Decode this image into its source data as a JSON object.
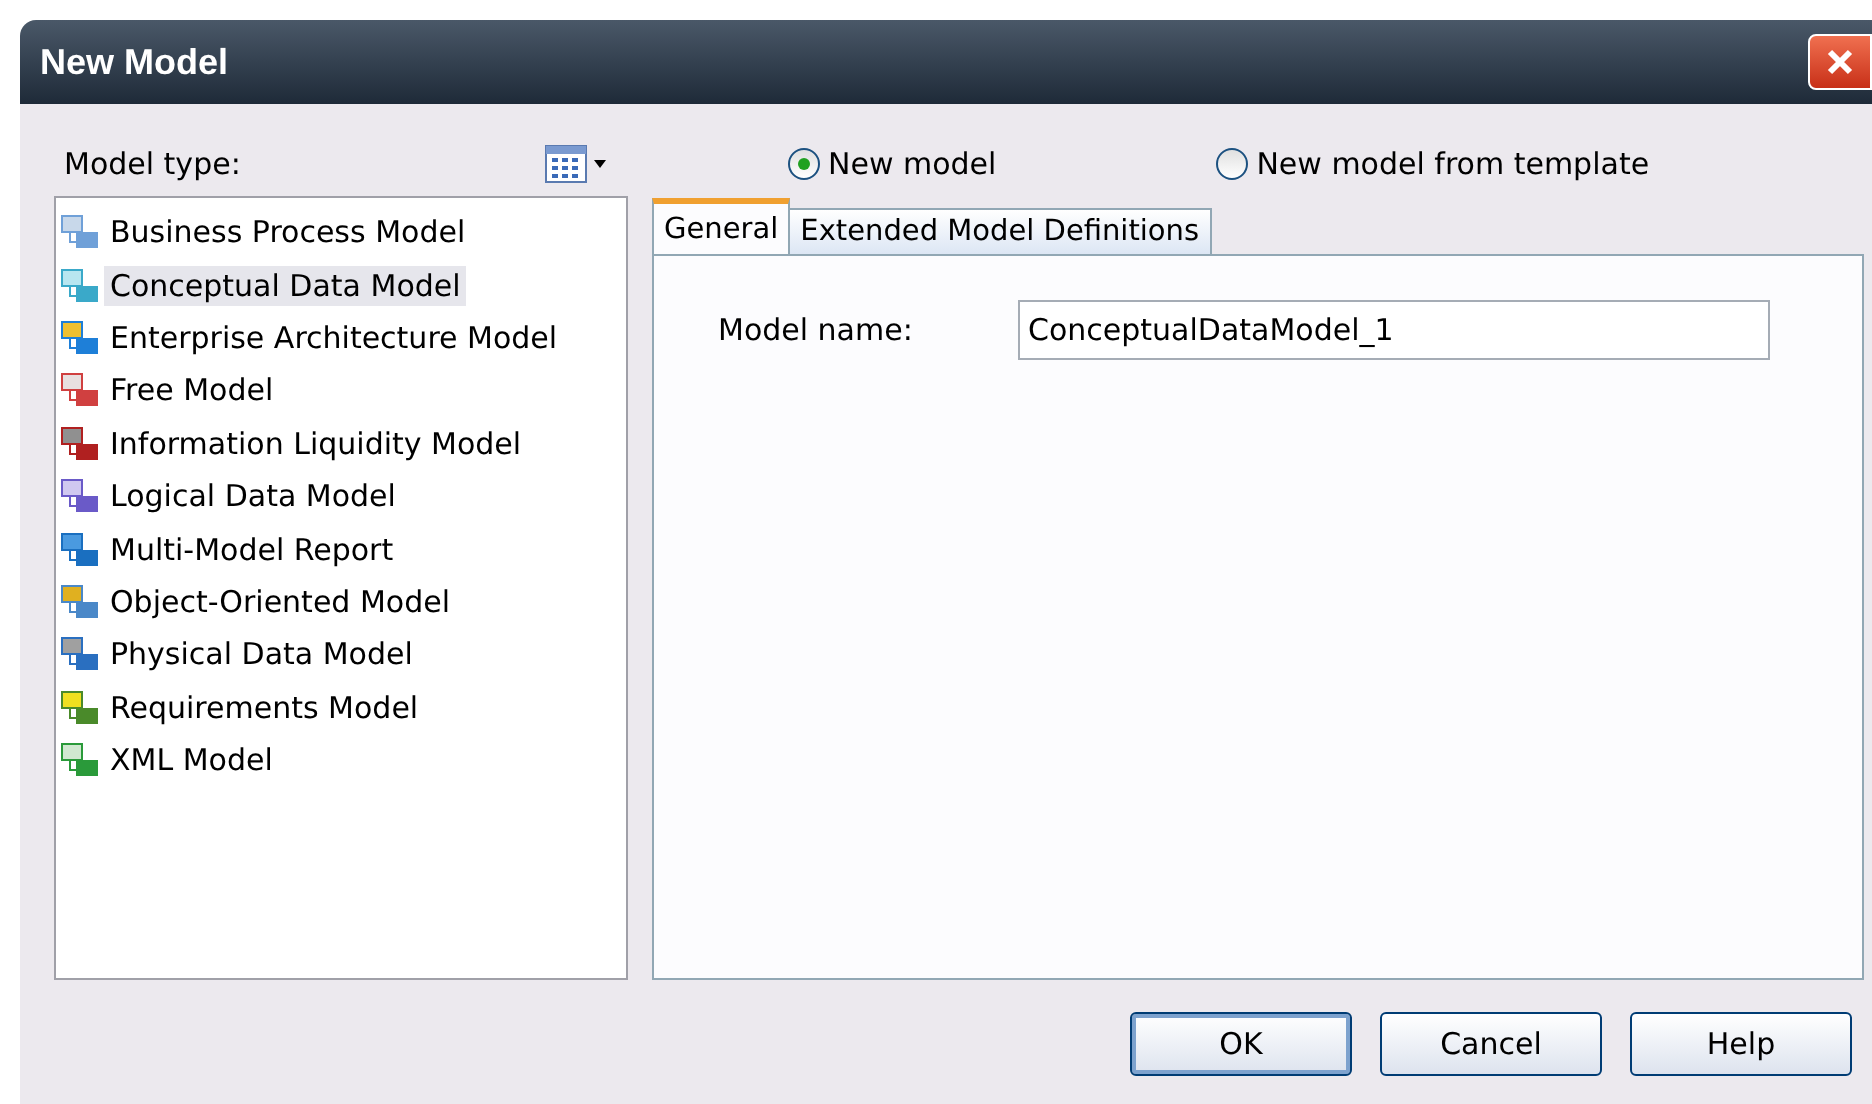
{
  "window": {
    "title": "New Model"
  },
  "model_type": {
    "label": "Model type:",
    "items": [
      {
        "label": "Business Process Model",
        "selected": false
      },
      {
        "label": "Conceptual Data Model",
        "selected": true
      },
      {
        "label": "Enterprise Architecture Model",
        "selected": false
      },
      {
        "label": "Free Model",
        "selected": false
      },
      {
        "label": "Information Liquidity Model",
        "selected": false
      },
      {
        "label": "Logical Data Model",
        "selected": false
      },
      {
        "label": "Multi-Model Report",
        "selected": false
      },
      {
        "label": "Object-Oriented Model",
        "selected": false
      },
      {
        "label": "Physical Data Model",
        "selected": false
      },
      {
        "label": "Requirements Model",
        "selected": false
      },
      {
        "label": "XML Model",
        "selected": false
      }
    ]
  },
  "mode": [
    {
      "label": "New model",
      "selected": true
    },
    {
      "label": "New model from template",
      "selected": false
    }
  ],
  "tabs": [
    {
      "label": "General",
      "selected": true
    },
    {
      "label": "Extended Model Definitions",
      "selected": false
    }
  ],
  "model_name": {
    "label": "Model name:",
    "value": "ConceptualDataModel_1"
  },
  "buttons": [
    {
      "label": "OK",
      "default": true
    },
    {
      "label": "Cancel",
      "default": false
    },
    {
      "label": "Help",
      "default": false
    }
  ]
}
